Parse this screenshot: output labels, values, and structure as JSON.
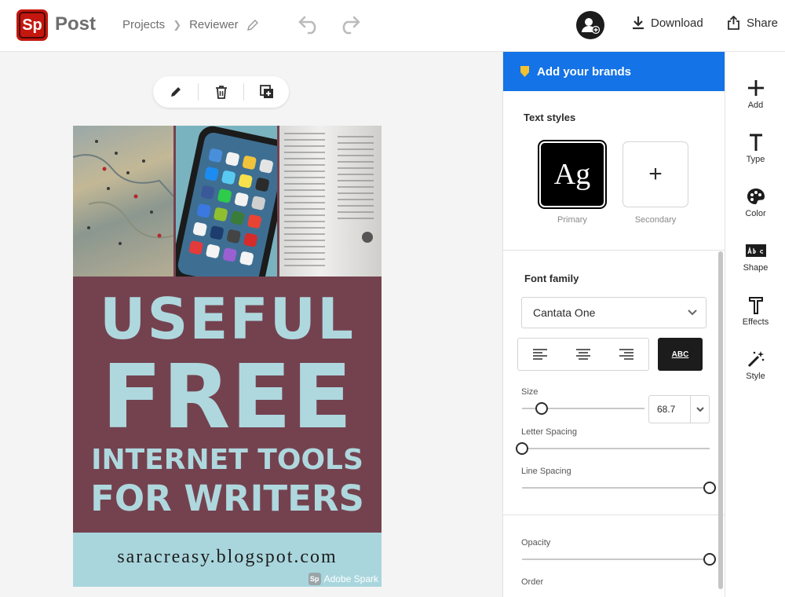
{
  "app": {
    "logo": "Sp",
    "name": "Post"
  },
  "breadcrumb": {
    "projects": "Projects",
    "current": "Reviewer"
  },
  "header": {
    "download_label": "Download",
    "share_label": "Share"
  },
  "poster": {
    "line1": "USEFUL",
    "line2": "FREE",
    "line3": "INTERNET TOOLS",
    "line4": "FOR WRITERS",
    "footer": "saracreasy.blogspot.com",
    "watermark_logo": "Sp",
    "watermark": "Adobe Spark",
    "colors": {
      "background": "#74424f",
      "text": "#aed8de",
      "footer_bg": "#a9d6dd"
    }
  },
  "panel": {
    "brands_label": "Add your brands",
    "text_styles_title": "Text styles",
    "primary_tile": "Ag",
    "primary_label": "Primary",
    "secondary_tile": "+",
    "secondary_label": "Secondary",
    "font_family_title": "Font family",
    "font_family_value": "Cantata One",
    "case_button": "ABC",
    "size_label": "Size",
    "size_value": "68.7",
    "size_fraction": 0.16,
    "letter_spacing_label": "Letter Spacing",
    "letter_spacing_fraction": 0.0,
    "line_spacing_label": "Line Spacing",
    "line_spacing_fraction": 1.0,
    "opacity_label": "Opacity",
    "opacity_fraction": 1.0,
    "order_label": "Order",
    "accent": "#1473e6"
  },
  "rail": {
    "items": [
      {
        "label": "Add",
        "icon": "plus-icon"
      },
      {
        "label": "Type",
        "icon": "type-icon"
      },
      {
        "label": "Color",
        "icon": "palette-icon"
      },
      {
        "label": "Shape",
        "icon": "abc-shape-icon"
      },
      {
        "label": "Effects",
        "icon": "effects-icon"
      },
      {
        "label": "Style",
        "icon": "magic-wand-icon"
      }
    ]
  }
}
